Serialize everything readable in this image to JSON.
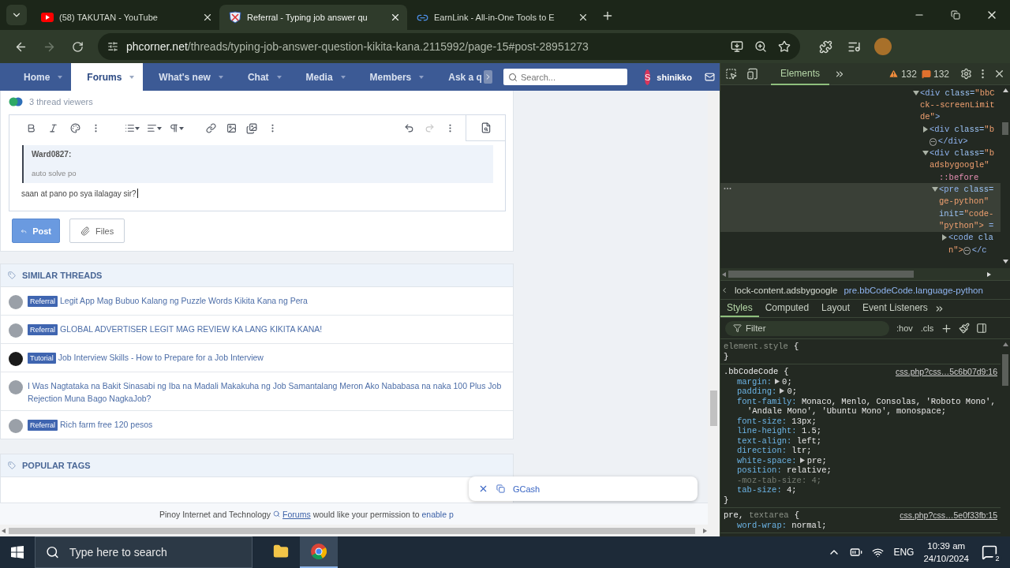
{
  "browser": {
    "tabs": [
      {
        "title": "(58) TAKUTAN - YouTube",
        "kind": "video",
        "selected": false
      },
      {
        "title": "Referral - Typing job answer qu",
        "kind": "forum",
        "selected": true
      },
      {
        "title": "EarnLink - All-in-One Tools to E",
        "kind": "link",
        "selected": false
      }
    ],
    "url_host": "phcorner.net",
    "url_path": "/threads/typing-job-answer-question-kikita-kana.2115992/page-15#post-28951273"
  },
  "forum": {
    "nav": [
      {
        "label": "Home",
        "selected": false
      },
      {
        "label": "Forums",
        "selected": true
      },
      {
        "label": "What's new",
        "selected": false
      },
      {
        "label": "Chat",
        "selected": false
      },
      {
        "label": "Media",
        "selected": false
      },
      {
        "label": "Members",
        "selected": false
      },
      {
        "label": "Ask a q",
        "selected": false
      }
    ],
    "search_placeholder": "Search...",
    "user": {
      "initial": "S",
      "name": "shinikko"
    },
    "viewers": "3 thread viewers",
    "editor": {
      "quote_author": "Ward0827:",
      "quote_text": "auto solve po",
      "text": "saan at pano po sya ilalagay sir?"
    },
    "actions": [
      {
        "label": "Post",
        "kind": "primary"
      },
      {
        "label": "Files",
        "kind": "secondary"
      }
    ],
    "similar_threads": {
      "title": "SIMILAR THREADS",
      "items": [
        {
          "tag": "Referral",
          "title": "Legit App Mag Bubuo Kalang ng Puzzle Words Kikita Kana ng Pera"
        },
        {
          "tag": "Referral",
          "title": "GLOBAL ADVERTISER LEGIT MAG REVIEW KA LANG KIKITA KANA!"
        },
        {
          "tag": "Tutorial",
          "title": "Job Interview Skills - How to Prepare for a Job Interview"
        },
        {
          "title": "I Was Nagtataka na Bakit Sinasabi ng Iba na Madali Makakuha ng Job Samantalang Meron Ako Nababasa na naka 100 Plus Job Rejection Muna Bago NagkaJob?"
        },
        {
          "tag": "Referral",
          "title": "Rich farm free 120 pesos"
        }
      ]
    },
    "popular_tags": {
      "title": "POPULAR TAGS"
    },
    "consent": {
      "site": "Pinoy Internet and Technology",
      "link": "Forums",
      "message": "would like your permission to",
      "action": "enable p"
    },
    "popup": {
      "label": "GCash"
    }
  },
  "devtools": {
    "tabs": [
      {
        "label": "Elements",
        "selected": true
      }
    ],
    "warnings": "132",
    "issues": "132",
    "dom": [
      {
        "expanded": true,
        "selected": false,
        "lines": [
          [
            {
              "kind": "tag",
              "text": "<div"
            },
            {
              "kind": "attr",
              "text": " class="
            },
            {
              "kind": "value",
              "text": "\"bbC"
            }
          ],
          [
            {
              "kind": "value",
              "text": "ck--screenLimit"
            }
          ],
          [
            {
              "kind": "value",
              "text": "de\""
            },
            {
              "kind": "tag",
              "text": ">"
            }
          ]
        ],
        "children": [
          {
            "expanded": false,
            "selected": false,
            "lines": [
              [
                {
                  "kind": "tag",
                  "text": "<div"
                },
                {
                  "kind": "attr",
                  "text": " class="
                },
                {
                  "kind": "value",
                  "text": "\"b"
                }
              ],
              [
                {
                  "kind": "badge",
                  "text": "⋯"
                },
                {
                  "kind": "tag",
                  "text": "</div>"
                }
              ]
            ]
          },
          {
            "expanded": true,
            "selected": false,
            "lines": [
              [
                {
                  "kind": "tag",
                  "text": "<div"
                },
                {
                  "kind": "attr",
                  "text": " class="
                },
                {
                  "kind": "value",
                  "text": "\"b"
                }
              ],
              [
                {
                  "kind": "value",
                  "text": "adsbygoogle\""
                }
              ]
            ],
            "children": [
              {
                "selected": false,
                "lines": [
                  [
                    {
                      "kind": "pseudo",
                      "text": "::before"
                    }
                  ]
                ]
              },
              {
                "expanded": true,
                "selected": true,
                "lines": [
                  [
                    {
                      "kind": "tag",
                      "text": "<pre"
                    },
                    {
                      "kind": "attr",
                      "text": " class="
                    }
                  ],
                  [
                    {
                      "kind": "value",
                      "text": "ge-python\""
                    }
                  ],
                  [
                    {
                      "kind": "attr",
                      "text": "init="
                    },
                    {
                      "kind": "value",
                      "text": "\"code-"
                    }
                  ],
                  [
                    {
                      "kind": "value",
                      "text": "\"python\">"
                    },
                    {
                      "kind": "tag",
                      "text": " ="
                    }
                  ]
                ],
                "children": [
                  {
                    "expanded": false,
                    "selected": false,
                    "lines": [
                      [
                        {
                          "kind": "tag",
                          "text": "<code"
                        },
                        {
                          "kind": "attr",
                          "text": " cla"
                        }
                      ],
                      [
                        {
                          "kind": "value",
                          "text": "n\">"
                        },
                        {
                          "kind": "badge",
                          "text": "⋯"
                        },
                        {
                          "kind": "tag",
                          "text": "</c"
                        }
                      ]
                    ]
                  }
                ]
              }
            ]
          }
        ]
      }
    ],
    "breadcrumbs": [
      {
        "label": "lock-content.adsbygoogle",
        "selected": false
      },
      {
        "label": "pre.bbCodeCode.language-python",
        "selected": true
      }
    ],
    "style_tabs": [
      {
        "label": "Styles",
        "selected": true
      },
      {
        "label": "Computed",
        "selected": false
      },
      {
        "label": "Layout",
        "selected": false
      },
      {
        "label": "Event Listeners",
        "selected": false
      }
    ],
    "filter_placeholder": "Filter",
    "toggles": [
      ":hov",
      ".cls"
    ],
    "rules": [
      {
        "selector": [
          {
            "text": "element.style",
            "matched": false
          }
        ],
        "open": "{",
        "close": "}"
      },
      {
        "selector": [
          {
            "text": ".bbCodeCode",
            "matched": true
          }
        ],
        "open": "{",
        "close": "}",
        "source": "css.php?css…5c6b07d9:16",
        "props": [
          {
            "name": "margin:",
            "value": "0;",
            "expandable": true,
            "disabled": false
          },
          {
            "name": "padding:",
            "value": "0;",
            "expandable": true,
            "disabled": false
          },
          {
            "name": "font-family:",
            "value": "Monaco, Menlo, Consolas, 'Roboto Mono', 'Andale Mono', 'Ubuntu Mono', monospace;",
            "expandable": false,
            "disabled": false
          },
          {
            "name": "font-size:",
            "value": "13px;",
            "expandable": false,
            "disabled": false
          },
          {
            "name": "line-height:",
            "value": "1.5;",
            "expandable": false,
            "disabled": false
          },
          {
            "name": "text-align:",
            "value": "left;",
            "expandable": false,
            "disabled": false
          },
          {
            "name": "direction:",
            "value": "ltr;",
            "expandable": false,
            "disabled": false
          },
          {
            "name": "white-space:",
            "value": "pre;",
            "expandable": true,
            "disabled": false
          },
          {
            "name": "position:",
            "value": "relative;",
            "expandable": false,
            "disabled": false
          },
          {
            "name": "-moz-tab-size:",
            "value": "4;",
            "expandable": false,
            "disabled": true
          },
          {
            "name": "tab-size:",
            "value": "4;",
            "expandable": false,
            "disabled": false
          }
        ]
      },
      {
        "selector": [
          {
            "text": "pre,",
            "matched": true
          },
          {
            "text": "textarea",
            "matched": false
          }
        ],
        "open": "{",
        "source": "css.php?css…5e0f33fb:15",
        "props": [
          {
            "name": "word-wrap:",
            "value": "normal;",
            "expandable": false,
            "disabled": false
          }
        ]
      }
    ]
  },
  "taskbar": {
    "search_placeholder": "Type here to search",
    "apps": [
      {
        "kind": "explorer",
        "selected": false
      },
      {
        "kind": "chrome",
        "selected": true
      }
    ],
    "language": "ENG",
    "time": "10:39 am",
    "date": "24/10/2024",
    "notifications": "2"
  }
}
